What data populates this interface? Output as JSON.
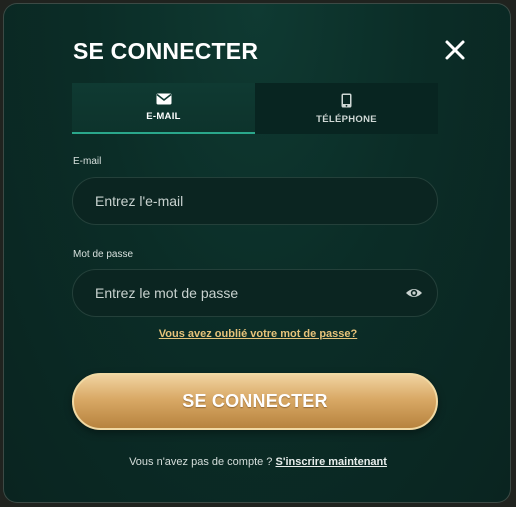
{
  "modal": {
    "title": "SE CONNECTER"
  },
  "tabs": [
    {
      "label": "E-MAIL",
      "icon": "envelope-icon",
      "active": true
    },
    {
      "label": "TÉLÉPHONE",
      "icon": "phone-icon",
      "active": false
    }
  ],
  "form": {
    "email_label": "E-mail",
    "email_placeholder": "Entrez l'e-mail",
    "password_label": "Mot de passe",
    "password_placeholder": "Entrez le mot de passe",
    "forgot_link": "Vous avez oublié votre mot de passe?",
    "submit_label": "SE CONNECTER"
  },
  "footer": {
    "prompt": "Vous n'avez pas de compte ?",
    "signup_link": "S'inscrire maintenant"
  },
  "colors": {
    "accent_tab": "#2aa78b",
    "gold": "#d9a966",
    "link_gold": "#e6c37a",
    "modal_bg": "#0b2d27"
  }
}
